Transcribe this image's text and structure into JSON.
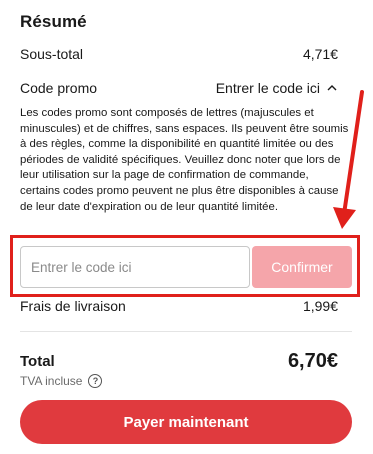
{
  "summary": {
    "title": "Résumé",
    "subtotal_label": "Sous-total",
    "subtotal_value": "4,71€"
  },
  "promo": {
    "label": "Code promo",
    "toggle_label": "Entrer le code ici",
    "description": "Les codes promo sont composés de lettres (majuscules et minuscules) et de chiffres, sans espaces. Ils peuvent être soumis à des règles, comme la disponibilité en quantité limitée ou des périodes de validité spécifiques. Veuillez donc noter que lors de leur utilisation sur la page de confirmation de commande, certains codes promo peuvent ne plus être disponibles à cause de leur date d'expiration ou de leur quantité limitée.",
    "input_placeholder": "Entrer le code ici",
    "input_value": "",
    "confirm_label": "Confirmer"
  },
  "delivery": {
    "label": "Frais de livraison",
    "value": "1,99€"
  },
  "total": {
    "label": "Total",
    "value": "6,70€",
    "tax_note": "TVA incluse"
  },
  "pay_button_label": "Payer maintenant",
  "colors": {
    "accent": "#e03a3e",
    "confirm_disabled": "#f5a5aa",
    "annotation": "#e0201b"
  },
  "icons": {
    "promo_toggle": "chevron-up-icon",
    "tax_help": "question-circle-icon",
    "annotation_arrow": "arrow-icon"
  }
}
